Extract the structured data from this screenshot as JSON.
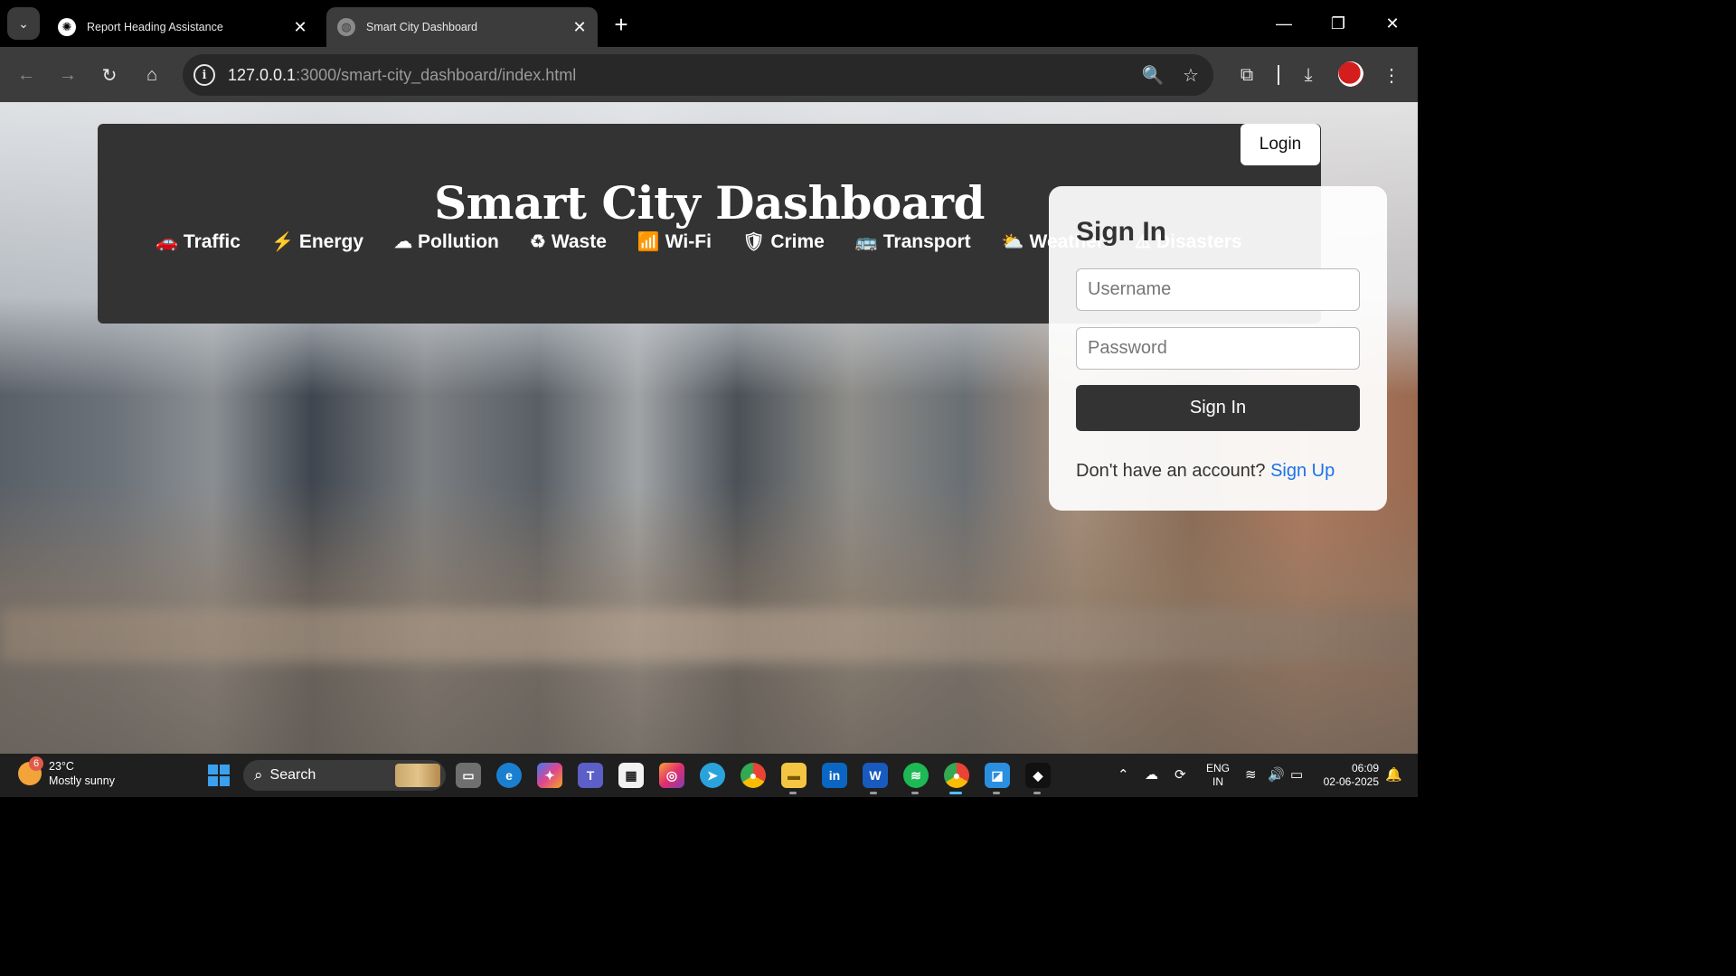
{
  "browser": {
    "tabs": [
      {
        "title": "Report Heading Assistance",
        "favicon": "openai-icon",
        "active": false
      },
      {
        "title": "Smart City Dashboard",
        "favicon": "globe-icon",
        "active": true
      }
    ],
    "url_host": "127.0.0.1",
    "url_rest": ":3000/smart-city_dashboard/index.html"
  },
  "page": {
    "title": "Smart City Dashboard",
    "login_label": "Login",
    "nav": [
      {
        "label": "Traffic",
        "icon": "car-icon",
        "glyph": "🚗"
      },
      {
        "label": "Energy",
        "icon": "bolt-icon",
        "glyph": "⚡"
      },
      {
        "label": "Pollution",
        "icon": "smog-icon",
        "glyph": "☁"
      },
      {
        "label": "Waste",
        "icon": "recycle-icon",
        "glyph": "♻"
      },
      {
        "label": "Wi-Fi",
        "icon": "wifi-icon",
        "glyph": "📶"
      },
      {
        "label": "Crime",
        "icon": "shield-icon",
        "glyph": "🛡"
      },
      {
        "label": "Transport",
        "icon": "bus-icon",
        "glyph": "🚌"
      },
      {
        "label": "Weather",
        "icon": "cloud-sun-icon",
        "glyph": "⛅"
      },
      {
        "label": "Disasters",
        "icon": "warning-icon",
        "glyph": "⚠"
      }
    ],
    "signin": {
      "title": "Sign In",
      "username_placeholder": "Username",
      "password_placeholder": "Password",
      "button_label": "Sign In",
      "prompt": "Don't have an account?",
      "signup_link": "Sign Up"
    }
  },
  "taskbar": {
    "weather_temp": "23°C",
    "weather_desc": "Mostly sunny",
    "weather_badge": "6",
    "search_label": "Search",
    "lang_line1": "ENG",
    "lang_line2": "IN",
    "time": "06:09",
    "date": "02-06-2025"
  },
  "colors": {
    "header_bg": "#333333",
    "link": "#1a73e8",
    "browser_dark": "#3c3c3c"
  }
}
